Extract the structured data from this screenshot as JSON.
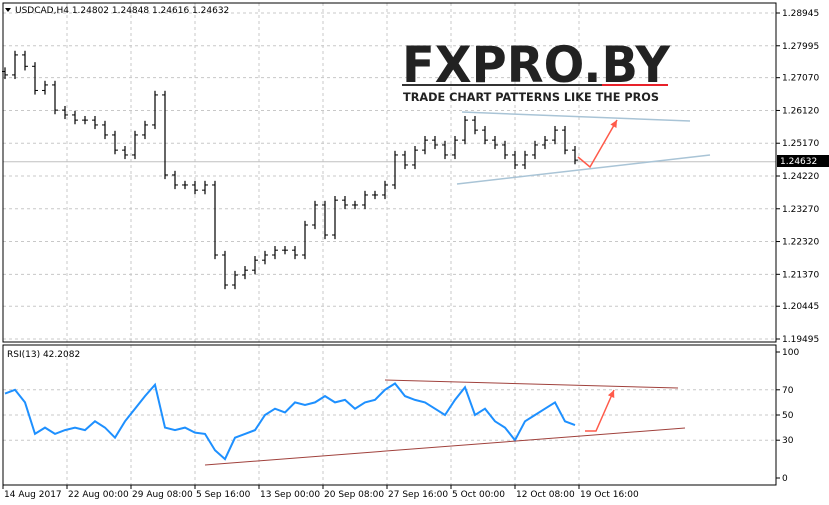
{
  "header": {
    "symbol_info": "USDCAD,H4  1.24802 1.24848 1.24616 1.24632"
  },
  "logo": {
    "brand": "FXPRO.BY",
    "tagline": "TRADE CHART PATTERNS LIKE THE PROS"
  },
  "chart_data": [
    {
      "type": "bar",
      "title": "USDCAD,H4",
      "ohlc_last": {
        "open": 1.24802,
        "high": 1.24848,
        "low": 1.24616,
        "close": 1.24632
      },
      "current_price_label": "1.24632",
      "current_price": 1.24632,
      "ylim": [
        1.19495,
        1.28945
      ],
      "y_ticks": [
        "1.28945",
        "1.27995",
        "1.27070",
        "1.26120",
        "1.25170",
        "1.24220",
        "1.23270",
        "1.22320",
        "1.21370",
        "1.20445",
        "1.19495"
      ],
      "x_ticks": [
        "14 Aug 2017",
        "22 Aug 00:00",
        "29 Aug 08:00",
        "5 Sep 16:00",
        "13 Sep 00:00",
        "20 Sep 08:00",
        "27 Sep 16:00",
        "5 Oct 00:00",
        "12 Oct 08:00",
        "19 Oct 16:00"
      ],
      "closes": [
        1.2715,
        1.2773,
        1.274,
        1.267,
        1.2686,
        1.2613,
        1.2599,
        1.2584,
        1.2584,
        1.257,
        1.2541,
        1.2497,
        1.2483,
        1.2541,
        1.257,
        1.2657,
        1.2425,
        1.2396,
        1.2396,
        1.2381,
        1.2396,
        1.2193,
        1.2106,
        1.2135,
        1.2149,
        1.2178,
        1.2193,
        1.2207,
        1.2207,
        1.2193,
        1.228,
        1.2338,
        1.2251,
        1.2352,
        1.2338,
        1.2338,
        1.2367,
        1.2367,
        1.2396,
        1.2483,
        1.2454,
        1.2497,
        1.2526,
        1.2512,
        1.2483,
        1.2526,
        1.2584,
        1.2555,
        1.2526,
        1.2512,
        1.2483,
        1.2454,
        1.2483,
        1.2512,
        1.2526,
        1.2555,
        1.2497,
        1.2468
      ],
      "colors": {
        "bars": "#000000",
        "trendline": "#a9c4d6",
        "arrow": "#ff5a4a",
        "grid": "#c8c8c8"
      }
    },
    {
      "type": "line",
      "title": "RSI(13) 42.2082",
      "ylim": [
        0,
        100
      ],
      "y_ticks": [
        "100",
        "70",
        "50",
        "30",
        "0"
      ],
      "values": [
        67,
        70,
        60,
        35,
        40,
        35,
        38,
        40,
        38,
        45,
        40,
        32,
        45,
        55,
        65,
        74,
        40,
        38,
        40,
        36,
        35,
        22,
        15,
        32,
        35,
        38,
        50,
        55,
        52,
        60,
        58,
        60,
        65,
        60,
        62,
        55,
        60,
        62,
        70,
        75,
        65,
        62,
        60,
        55,
        50,
        62,
        72,
        50,
        55,
        45,
        40,
        30,
        45,
        50,
        55,
        60,
        45,
        42
      ],
      "colors": {
        "line": "#1e90ff",
        "trendline": "#a0413c",
        "arrow": "#ff5a4a"
      }
    }
  ]
}
